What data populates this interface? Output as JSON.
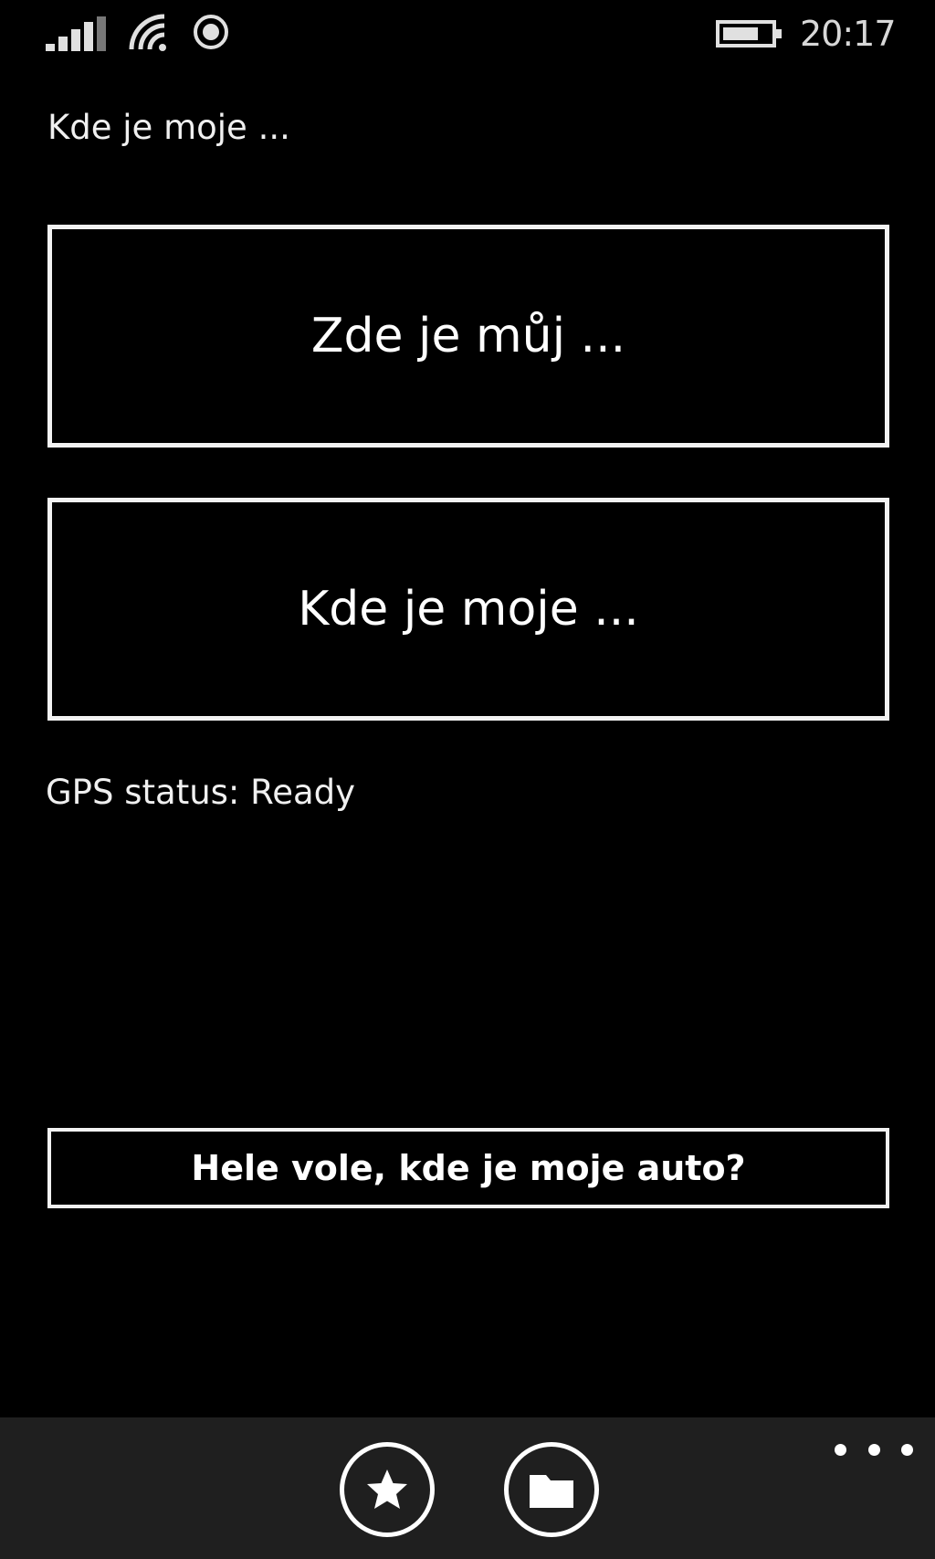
{
  "status_bar": {
    "time": "20:17",
    "icons": [
      "signal-icon",
      "wifi-icon",
      "location-icon",
      "battery-icon"
    ]
  },
  "page": {
    "title": "Kde je moje ..."
  },
  "buttons": {
    "here_label": "Zde je můj ...",
    "where_label": "Kde je moje ...",
    "find_label": "Hele vole, kde je moje auto?"
  },
  "gps": {
    "status_text": "GPS status: Ready"
  },
  "app_bar": {
    "buttons": [
      {
        "icon": "star-icon"
      },
      {
        "icon": "folder-icon"
      }
    ],
    "more_icon": "ellipsis-icon"
  },
  "colors": {
    "background": "#000000",
    "foreground": "#ffffff",
    "app_bar_background": "#1f1f1f"
  }
}
